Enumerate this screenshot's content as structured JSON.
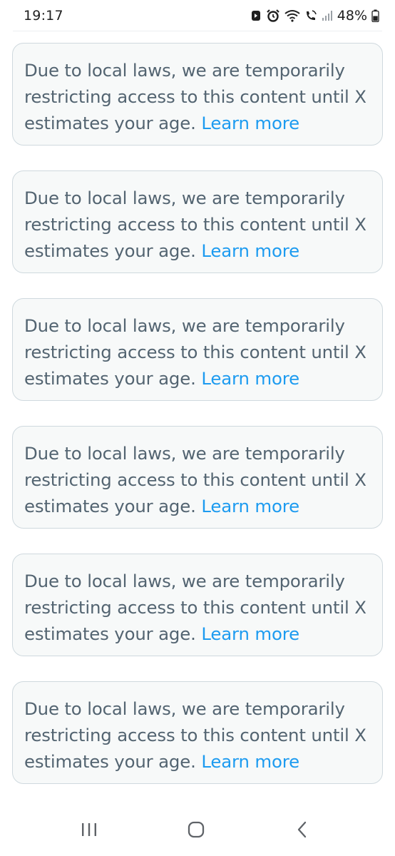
{
  "status_bar": {
    "time": "19:17",
    "battery": "48%",
    "icons": [
      "notification-icon",
      "alarm-icon",
      "wifi-icon",
      "wifi-calling-icon",
      "signal-icon",
      "battery-icon"
    ]
  },
  "notices": [
    {
      "message": "Due to local laws, we are temporarily restricting access to this content until X estimates your age.",
      "link": "Learn more"
    },
    {
      "message": "Due to local laws, we are temporarily restricting access to this content until X estimates your age.",
      "link": "Learn more"
    },
    {
      "message": "Due to local laws, we are temporarily restricting access to this content until X estimates your age.",
      "link": "Learn more"
    },
    {
      "message": "Due to local laws, we are temporarily restricting access to this content until X estimates your age.",
      "link": "Learn more"
    },
    {
      "message": "Due to local laws, we are temporarily restricting access to this content until X estimates your age.",
      "link": "Learn more"
    },
    {
      "message": "Due to local laws, we are temporarily restricting access to this content until X estimates your age.",
      "link": "Learn more"
    }
  ],
  "colors": {
    "card_bg": "#f7f9f9",
    "card_border": "#cfd9de",
    "text": "#536471",
    "link": "#1d9bf0"
  },
  "nav_bar": {
    "icons": [
      "recent-apps-icon",
      "home-icon",
      "back-icon"
    ]
  }
}
